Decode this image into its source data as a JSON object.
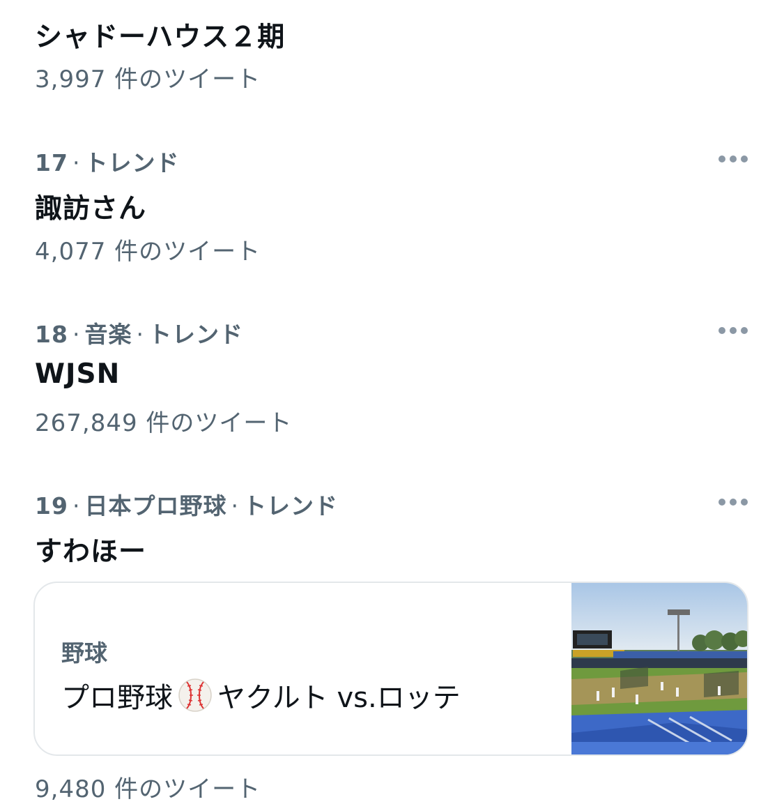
{
  "trends": [
    {
      "title": "シャドーハウス２期",
      "count": "3,997 件のツイート"
    },
    {
      "rank": "17",
      "meta": "トレンド",
      "title": "諏訪さん",
      "count": "4,077 件のツイート"
    },
    {
      "rank": "18",
      "category": "音楽",
      "meta": "トレンド",
      "title": "WJSN",
      "count": "267,849 件のツイート"
    },
    {
      "rank": "19",
      "category": "日本プロ野球",
      "meta": "トレンド",
      "title": "すわほー",
      "card": {
        "category": "野球",
        "title_a": "プロ野球",
        "emoji": "baseball-icon",
        "title_b": "ヤクルト vs.ロッテ"
      },
      "count": "9,480 件のツイート"
    }
  ],
  "dot": "·",
  "colors": {
    "text": "#0f1419",
    "secondary": "#536471",
    "border": "#e3e7ea"
  }
}
